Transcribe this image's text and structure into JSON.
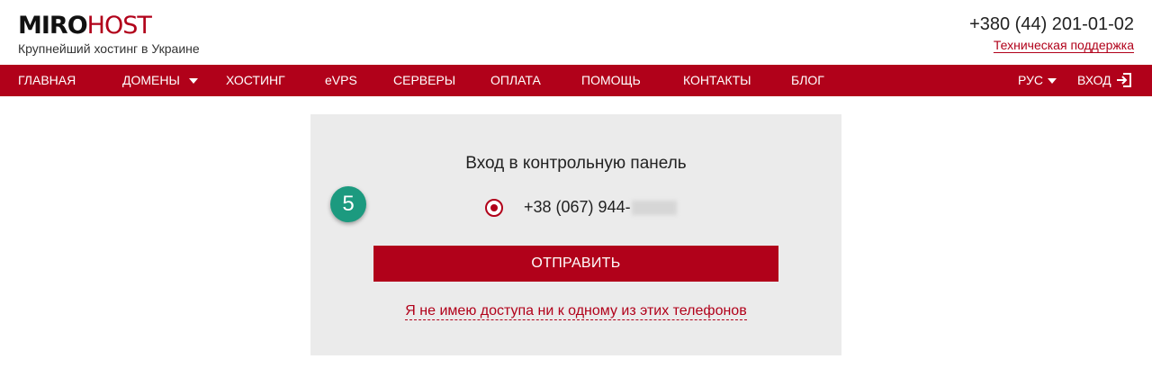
{
  "header": {
    "logo_part1": "MIRO",
    "logo_part2": "HOST",
    "tagline": "Крупнейший хостинг в Украине",
    "phone": "+380 (44) 201-01-02",
    "support_link": "Техническая поддержка"
  },
  "nav": {
    "items": [
      {
        "label": "ГЛАВНАЯ"
      },
      {
        "label": "ДОМЕНЫ"
      },
      {
        "label": "ХОСТИНГ"
      },
      {
        "label": "eVPS"
      },
      {
        "label": "СЕРВЕРЫ"
      },
      {
        "label": "ОПЛАТА"
      },
      {
        "label": "ПОМОЩЬ"
      },
      {
        "label": "КОНТАКТЫ"
      },
      {
        "label": "БЛОГ"
      }
    ],
    "language": "РУС",
    "login": "ВХОД"
  },
  "panel": {
    "title": "Вход в контрольную панель",
    "step_badge": "5",
    "phone_option": "+38 (067) 944-",
    "submit_label": "ОТПРАВИТЬ",
    "no_access_link": "Я не имею доступа ни к одному из этих телефонов"
  },
  "colors": {
    "brand": "#b1011a",
    "badge": "#1c9a7f",
    "panel_bg": "#ebebeb"
  },
  "icons": {
    "dropdown": "chevron-down-icon",
    "login": "login-icon",
    "radio": "radio-selected-icon"
  }
}
